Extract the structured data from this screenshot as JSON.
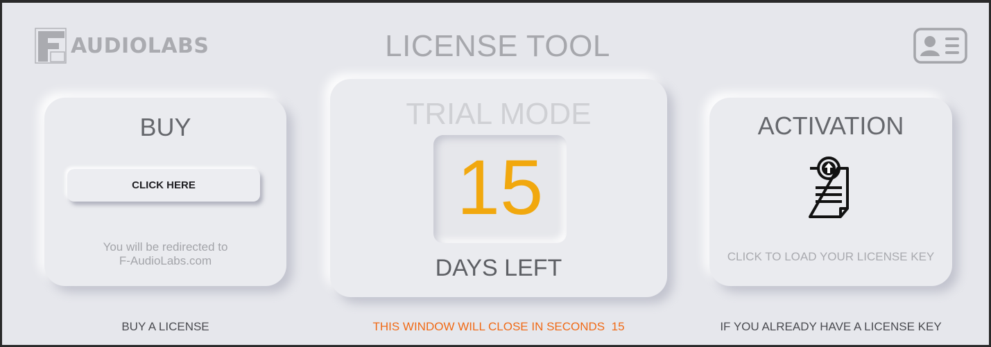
{
  "header": {
    "brand": "AUDIOLABS",
    "title": "LICENSE TOOL",
    "license_icon": "id-card-icon"
  },
  "buy": {
    "title": "BUY",
    "button_label": "CLICK HERE",
    "note_line1": "You will be redirected to",
    "note_line2": "F-AudioLabs.com",
    "footer": "BUY A LICENSE"
  },
  "trial": {
    "title": "TRIAL MODE",
    "days": "15",
    "days_label": "DAYS LEFT",
    "footer_text": "THIS WINDOW WILL CLOSE IN SECONDS",
    "seconds": "15"
  },
  "activation": {
    "title": "ACTIVATION",
    "icon": "upload-document-icon",
    "load_label": "CLICK TO LOAD YOUR LICENSE KEY",
    "footer": "IF YOU ALREADY HAVE A LICENSE KEY"
  },
  "colors": {
    "background": "#e6e7ec",
    "accent_orange": "#f06a16",
    "counter_yellow": "#f1a80e"
  }
}
